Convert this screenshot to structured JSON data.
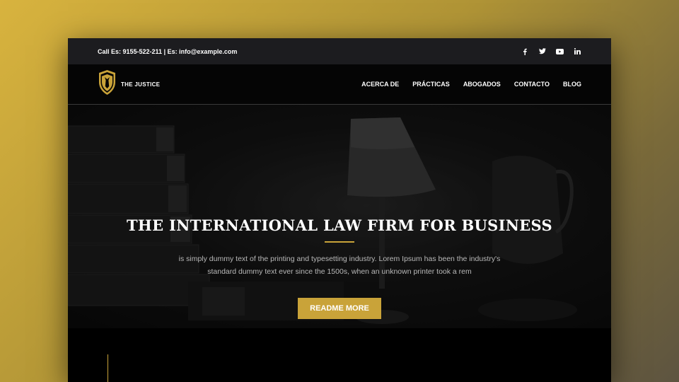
{
  "topbar": {
    "contact": "Call Es: 9155-522-211 | Es: info@example.com",
    "socials": [
      "facebook-icon",
      "twitter-icon",
      "youtube-icon",
      "linkedin-icon"
    ]
  },
  "nav": {
    "brand": "THE JUSTICE",
    "items": [
      {
        "label": "ACERCA DE"
      },
      {
        "label": "PRÁCTICAS"
      },
      {
        "label": "ABOGADOS"
      },
      {
        "label": "CONTACTO"
      },
      {
        "label": "BLOG"
      }
    ]
  },
  "hero": {
    "title": "THE INTERNATIONAL LAW FIRM FOR BUSINESS",
    "text": "is simply dummy text of the printing and typesetting industry. Lorem Ipsum has been the industry's standard dummy text ever since the 1500s, when an unknown printer took a rem",
    "button": "README MORE"
  },
  "colors": {
    "accent": "#c9a339",
    "topbar": "#1c1c1f",
    "nav": "#050505"
  }
}
